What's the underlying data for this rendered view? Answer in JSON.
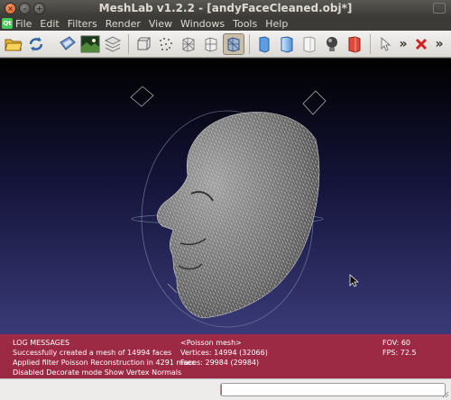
{
  "window": {
    "title": "MeshLab v1.2.2 - [andyFaceCleaned.obj*]",
    "close": "×",
    "minimize": "–",
    "maximize": "+"
  },
  "menubar": {
    "logo": "Qt",
    "items": [
      "File",
      "Edit",
      "Filters",
      "Render",
      "View",
      "Windows",
      "Tools",
      "Help"
    ]
  },
  "toolbar": {
    "overflow_1": "»",
    "overflow_2": "»",
    "icons": [
      "open-folder-icon",
      "reload-icon",
      "save-icon",
      "snapshot-icon",
      "layers-icon",
      "bounding-box-icon",
      "points-icon",
      "wireframe-icon",
      "hidden-lines-icon",
      "flat-lines-icon",
      "flat-icon",
      "smooth-icon",
      "texture-icon",
      "lighting-icon",
      "color-icon",
      "select-icon",
      "close-x-icon"
    ],
    "active": "flat-lines-icon"
  },
  "log": {
    "heading": "LOG MESSAGES",
    "lines": [
      "Successfully created a mesh of 14994 faces",
      "Applied filter Poisson Reconstruction in 4291 msec",
      "Disabled Decorate mode Show Vertex Normals"
    ]
  },
  "mesh_info": {
    "name": "<Poisson mesh>",
    "vertices": "Vertices: 14994 (32066)",
    "faces": "Faces: 29984 (29984)"
  },
  "view_info": {
    "fov": "FOV: 60",
    "fps": "FPS:   72.5"
  },
  "progress": {
    "value": 0.0
  },
  "colors": {
    "log_bg": "#aa2848",
    "viewport_top": "#000000",
    "viewport_bottom": "#3a3a78",
    "progress_fill": "#e05a28"
  }
}
